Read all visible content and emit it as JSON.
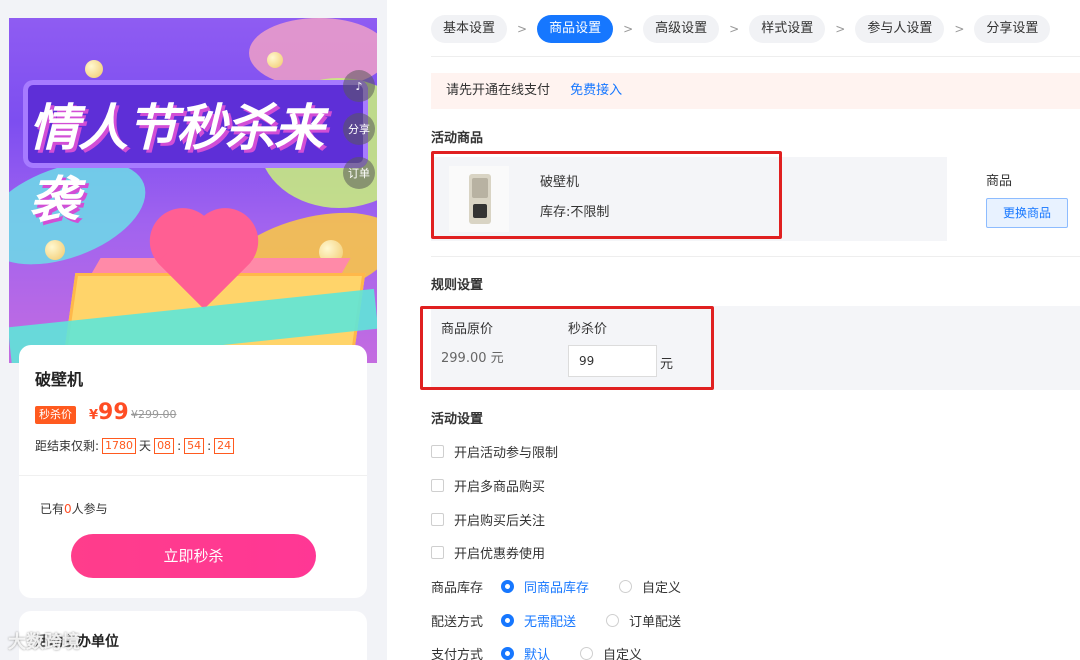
{
  "preview": {
    "poster_title": "情人节秒杀来袭",
    "side_buttons": [
      "♪",
      "分享",
      "订单"
    ],
    "product_title": "破壁机",
    "tag": "秒杀价",
    "currency": "¥",
    "price": "99",
    "original_price": "¥299.00",
    "countdown": {
      "prefix": "距结束仅剩:",
      "days": "1780",
      "day_unit": "天",
      "hours": "08",
      "minutes": "54",
      "seconds": "24",
      "colon": ":"
    },
    "joined": {
      "prefix": "已有",
      "count": "0",
      "suffix": "人参与"
    },
    "buy_button": "立即秒杀",
    "section2_title": "活动主办单位",
    "watermark": "大数跨境"
  },
  "settings": {
    "steps": [
      "基本设置",
      "商品设置",
      "高级设置",
      "样式设置",
      "参与人设置",
      "分享设置"
    ],
    "active_step": 1,
    "notice": {
      "text": "请先开通在线支付",
      "link": "免费接入"
    },
    "sections": {
      "activity_goods": "活动商品",
      "rule_settings": "规则设置",
      "activity_settings": "活动设置"
    },
    "product": {
      "name": "破壁机",
      "stock": "库存:不限制"
    },
    "goods_label": "商品",
    "change_button": "更换商品",
    "rule": {
      "original_label": "商品原价",
      "original_value": "299.00 元",
      "flash_label": "秒杀价",
      "flash_value": "99",
      "unit": "元"
    },
    "checkboxes": [
      "开启活动参与限制",
      "开启多商品购买",
      "开启购买后关注",
      "开启优惠券使用"
    ],
    "radios": [
      {
        "label": "商品库存",
        "options": [
          "同商品库存",
          "自定义"
        ],
        "selected": 0
      },
      {
        "label": "配送方式",
        "options": [
          "无需配送",
          "订单配送"
        ],
        "selected": 0
      },
      {
        "label": "支付方式",
        "options": [
          "默认",
          "自定义"
        ],
        "selected": 0
      }
    ]
  },
  "colors": {
    "primary": "#1677ff",
    "accent": "#ff4d24",
    "buy_button": "#ff3d8b",
    "highlight_frame": "#e02020"
  }
}
